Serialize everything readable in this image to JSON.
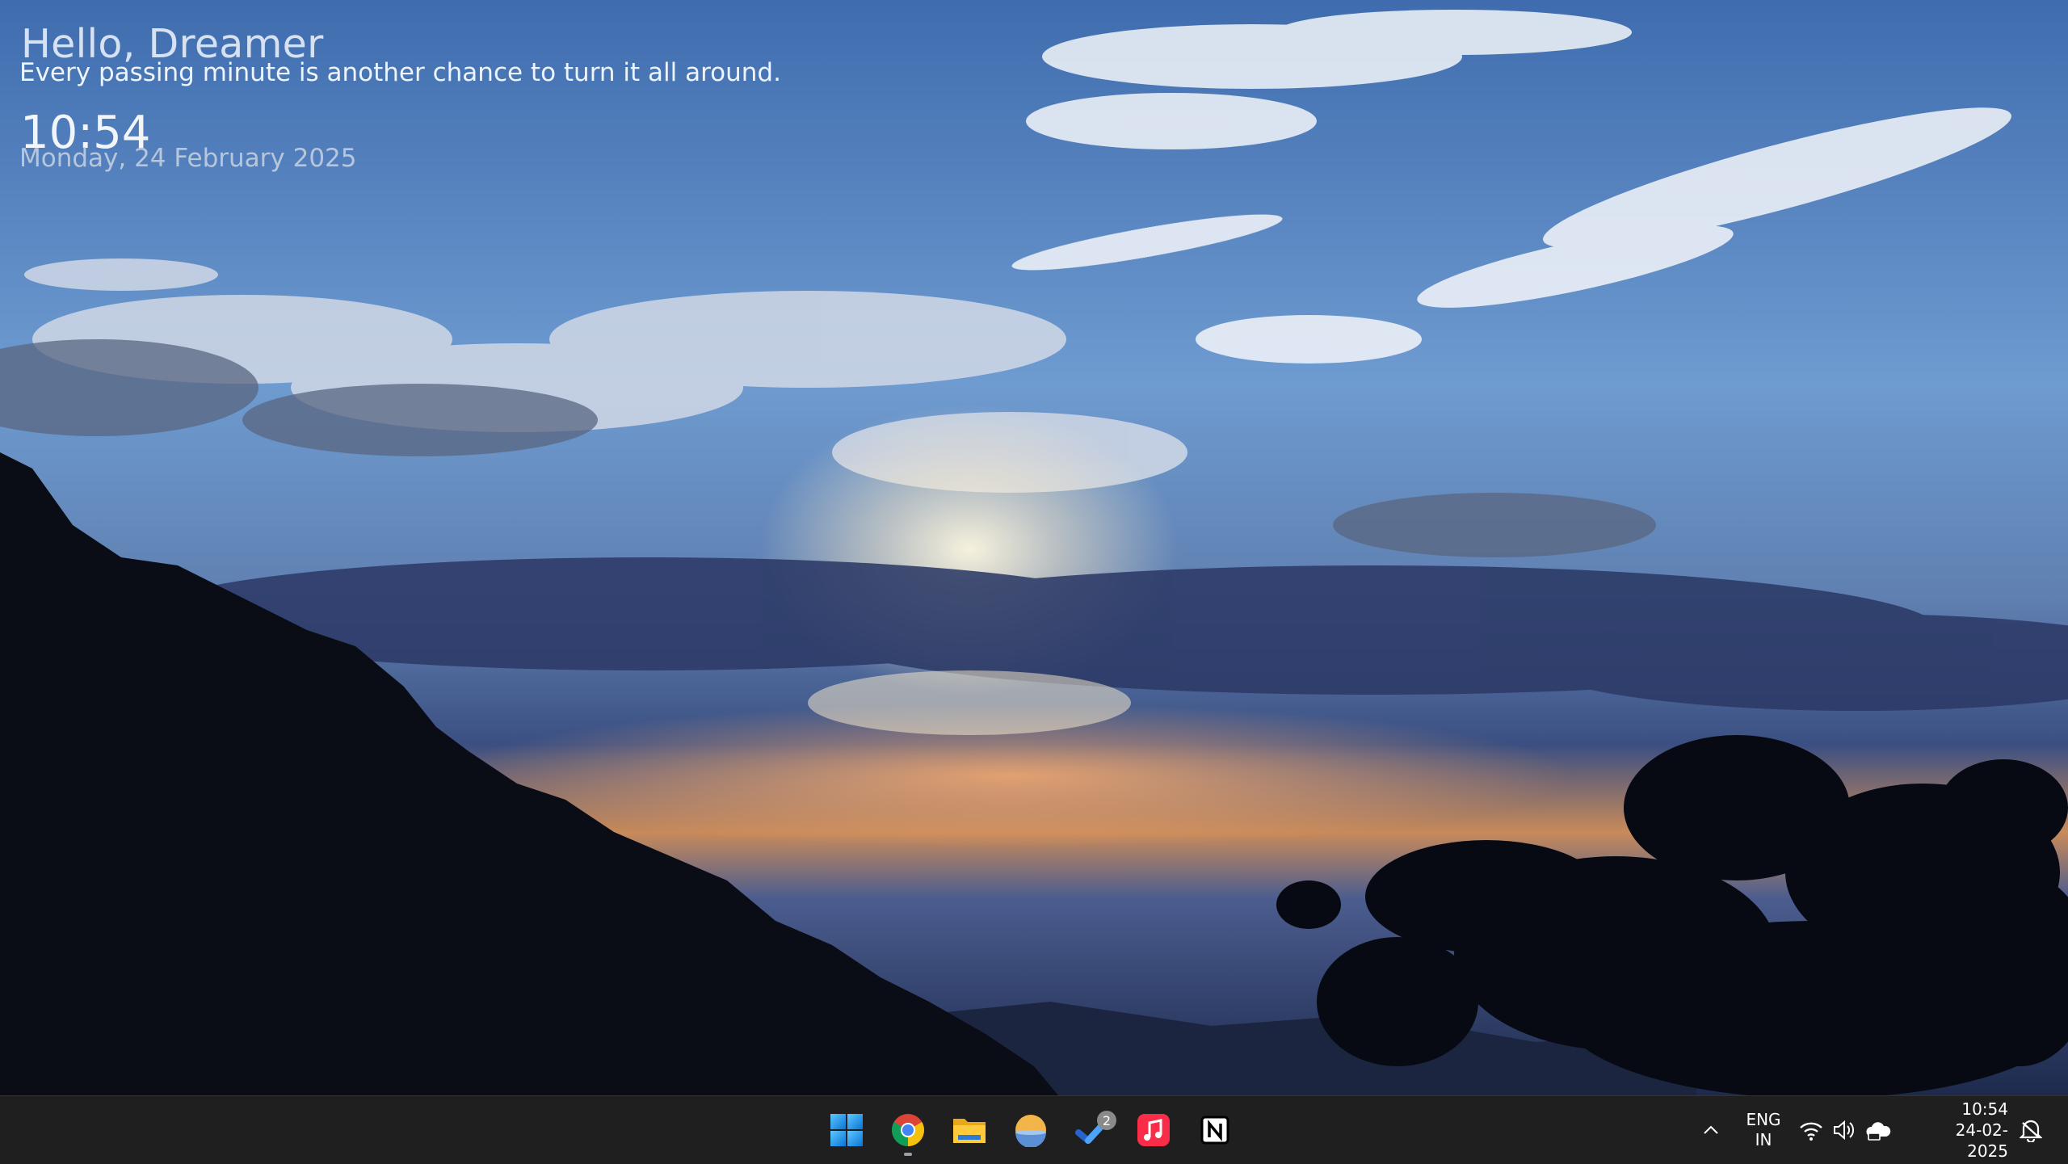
{
  "desktop": {
    "greeting": "Hello, Dreamer",
    "quote": "Every passing minute is another chance to turn it all around.",
    "clock_time": "10:54",
    "clock_date": "Monday, 24 February 2025"
  },
  "taskbar": {
    "apps": [
      {
        "name": "Start",
        "icon": "windows-start-icon",
        "running": false
      },
      {
        "name": "Google Chrome",
        "icon": "chrome-icon",
        "running": true
      },
      {
        "name": "File Explorer",
        "icon": "folder-icon",
        "running": false
      },
      {
        "name": "Weather",
        "icon": "weather-sun-icon",
        "running": false
      },
      {
        "name": "Microsoft To Do",
        "icon": "checkmark-icon",
        "running": false,
        "badge": "2"
      },
      {
        "name": "Apple Music",
        "icon": "music-note-icon",
        "running": false
      },
      {
        "name": "Notion",
        "icon": "notion-icon",
        "running": false
      }
    ],
    "tray": {
      "language_line1": "ENG",
      "language_line2": "IN",
      "time": "10:54",
      "date": "24-02-2025",
      "icons": [
        "chevron-up-icon",
        "wifi-icon",
        "volume-icon",
        "cloud-sync-icon",
        "notification-bell-icon"
      ]
    }
  },
  "colors": {
    "taskbar_bg": "#1f1f1f",
    "sky_top": "#4a78b8",
    "horizon": "#e08a4a",
    "music_red": "#fa2d48",
    "todo_blue": "#2564cf"
  }
}
